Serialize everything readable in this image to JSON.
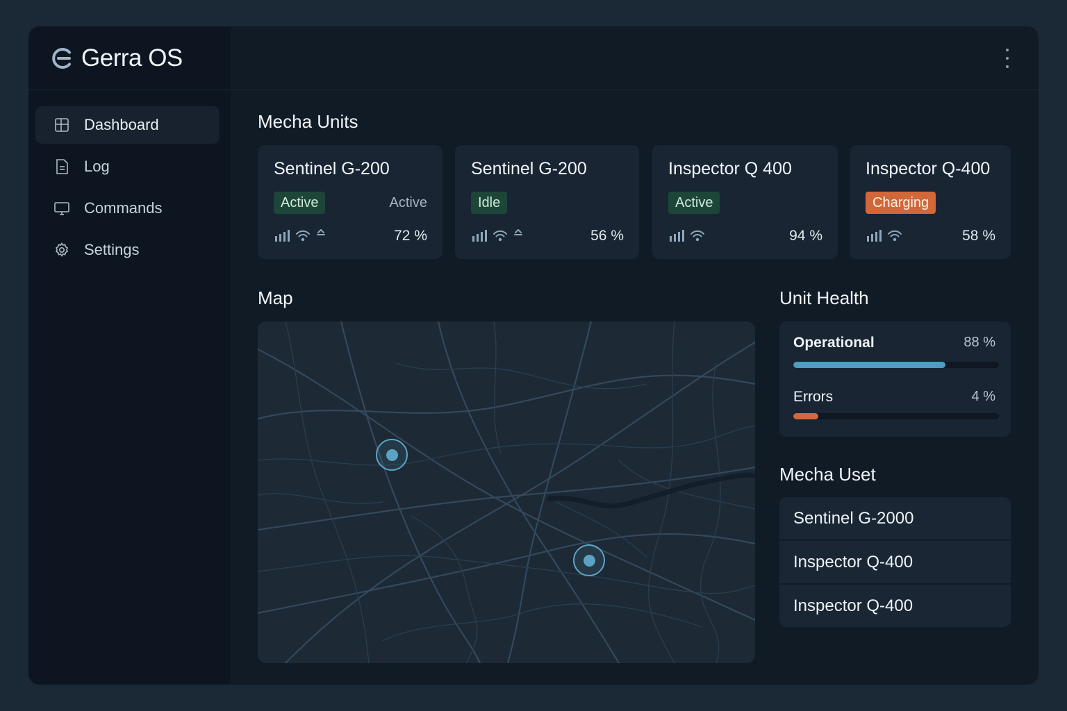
{
  "app": {
    "name": "Gerra OS"
  },
  "nav": [
    {
      "label": "Dashboard",
      "icon": "dashboard-icon",
      "active": true
    },
    {
      "label": "Log",
      "icon": "log-icon",
      "active": false
    },
    {
      "label": "Commands",
      "icon": "commands-icon",
      "active": false
    },
    {
      "label": "Settings",
      "icon": "settings-icon",
      "active": false
    }
  ],
  "units_section": {
    "title": "Mecha Units"
  },
  "units": [
    {
      "name": "Sentinel G-200",
      "badge": "Active",
      "badge_color": "green",
      "status": "Active",
      "battery": "72 %"
    },
    {
      "name": "Sentinel G-200",
      "badge": "Idle",
      "badge_color": "green",
      "status": "",
      "battery": "56 %"
    },
    {
      "name": "Inspector Q 400",
      "badge": "Active",
      "badge_color": "green",
      "status": "",
      "battery": "94 %"
    },
    {
      "name": "Inspector Q-400",
      "badge": "Charging",
      "badge_color": "orange",
      "status": "",
      "battery": "58 %"
    }
  ],
  "map": {
    "title": "Map",
    "marker_color": "#5ba3c4"
  },
  "health": {
    "title": "Unit Health",
    "operational": {
      "label": "Operational",
      "value": "88 %",
      "fraction": 0.74,
      "color": "#4a9fc2"
    },
    "errors": {
      "label": "Errors",
      "value": "4 %",
      "fraction": 0.12,
      "color": "#d2683a"
    }
  },
  "uset": {
    "title": "Mecha Uset",
    "items": [
      "Sentinel G-2000",
      "Inspector Q-400",
      "Inspector Q-400"
    ]
  }
}
